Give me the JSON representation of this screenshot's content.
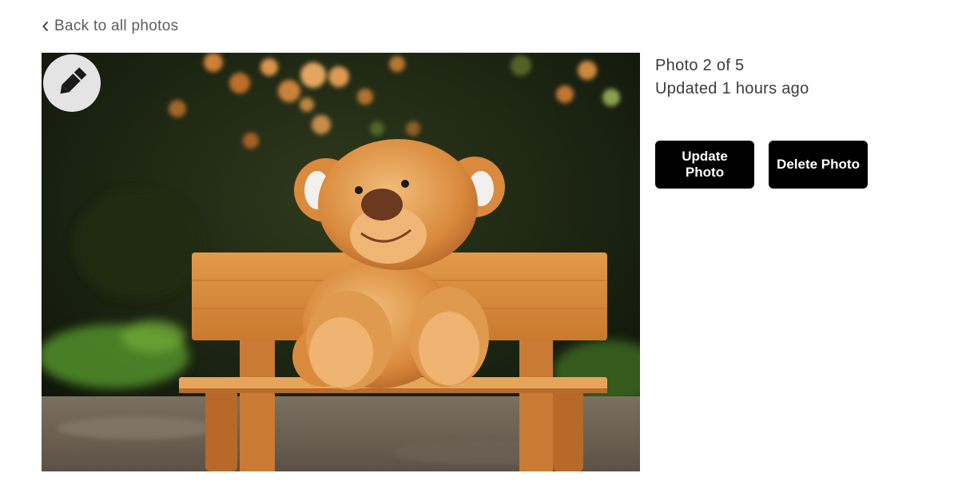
{
  "nav": {
    "back_label": "Back to all photos",
    "back_icon": "chevron-left-icon"
  },
  "photo": {
    "subject": "teddy bear on wooden bench",
    "edit_icon": "pencil-icon"
  },
  "info": {
    "position_text": "Photo 2 of 5",
    "updated_text": "Updated 1 hours ago"
  },
  "actions": {
    "update_label": "Update Photo",
    "delete_label": "Delete Photo"
  },
  "colors": {
    "button_bg": "#000000",
    "button_text": "#ffffff",
    "text": "#3b3b3b",
    "badge_bg": "#e4e4e4"
  }
}
